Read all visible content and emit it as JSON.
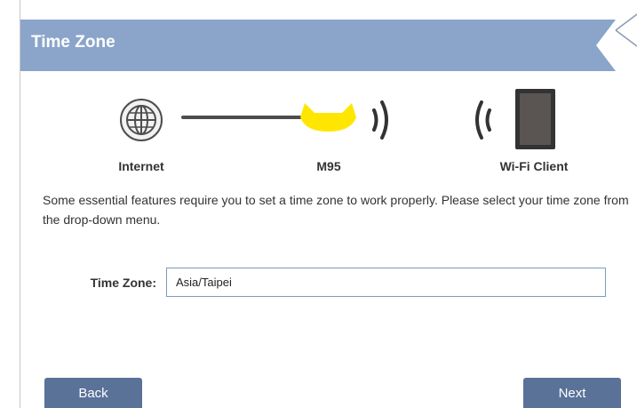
{
  "dialog": {
    "title": "Time Zone",
    "close_icon": "close-icon"
  },
  "diagram": {
    "internet_label": "Internet",
    "device_label": "M95",
    "client_label": "Wi-Fi Client",
    "icons": [
      "globe-icon",
      "connection-line",
      "extender-icon",
      "wifi-signal-icon",
      "tablet-icon"
    ],
    "device_color": "#ffe600"
  },
  "description": "Some essential features require you to set a time zone to work properly. Please select your time zone from the drop-down menu.",
  "time_zone": {
    "label": "Time Zone:",
    "value": "Asia/Taipei"
  },
  "buttons": {
    "back": "Back",
    "next": "Next"
  },
  "colors": {
    "header": "#8aa4ca",
    "button": "#5a7198",
    "input_border": "#7b9dbd"
  }
}
